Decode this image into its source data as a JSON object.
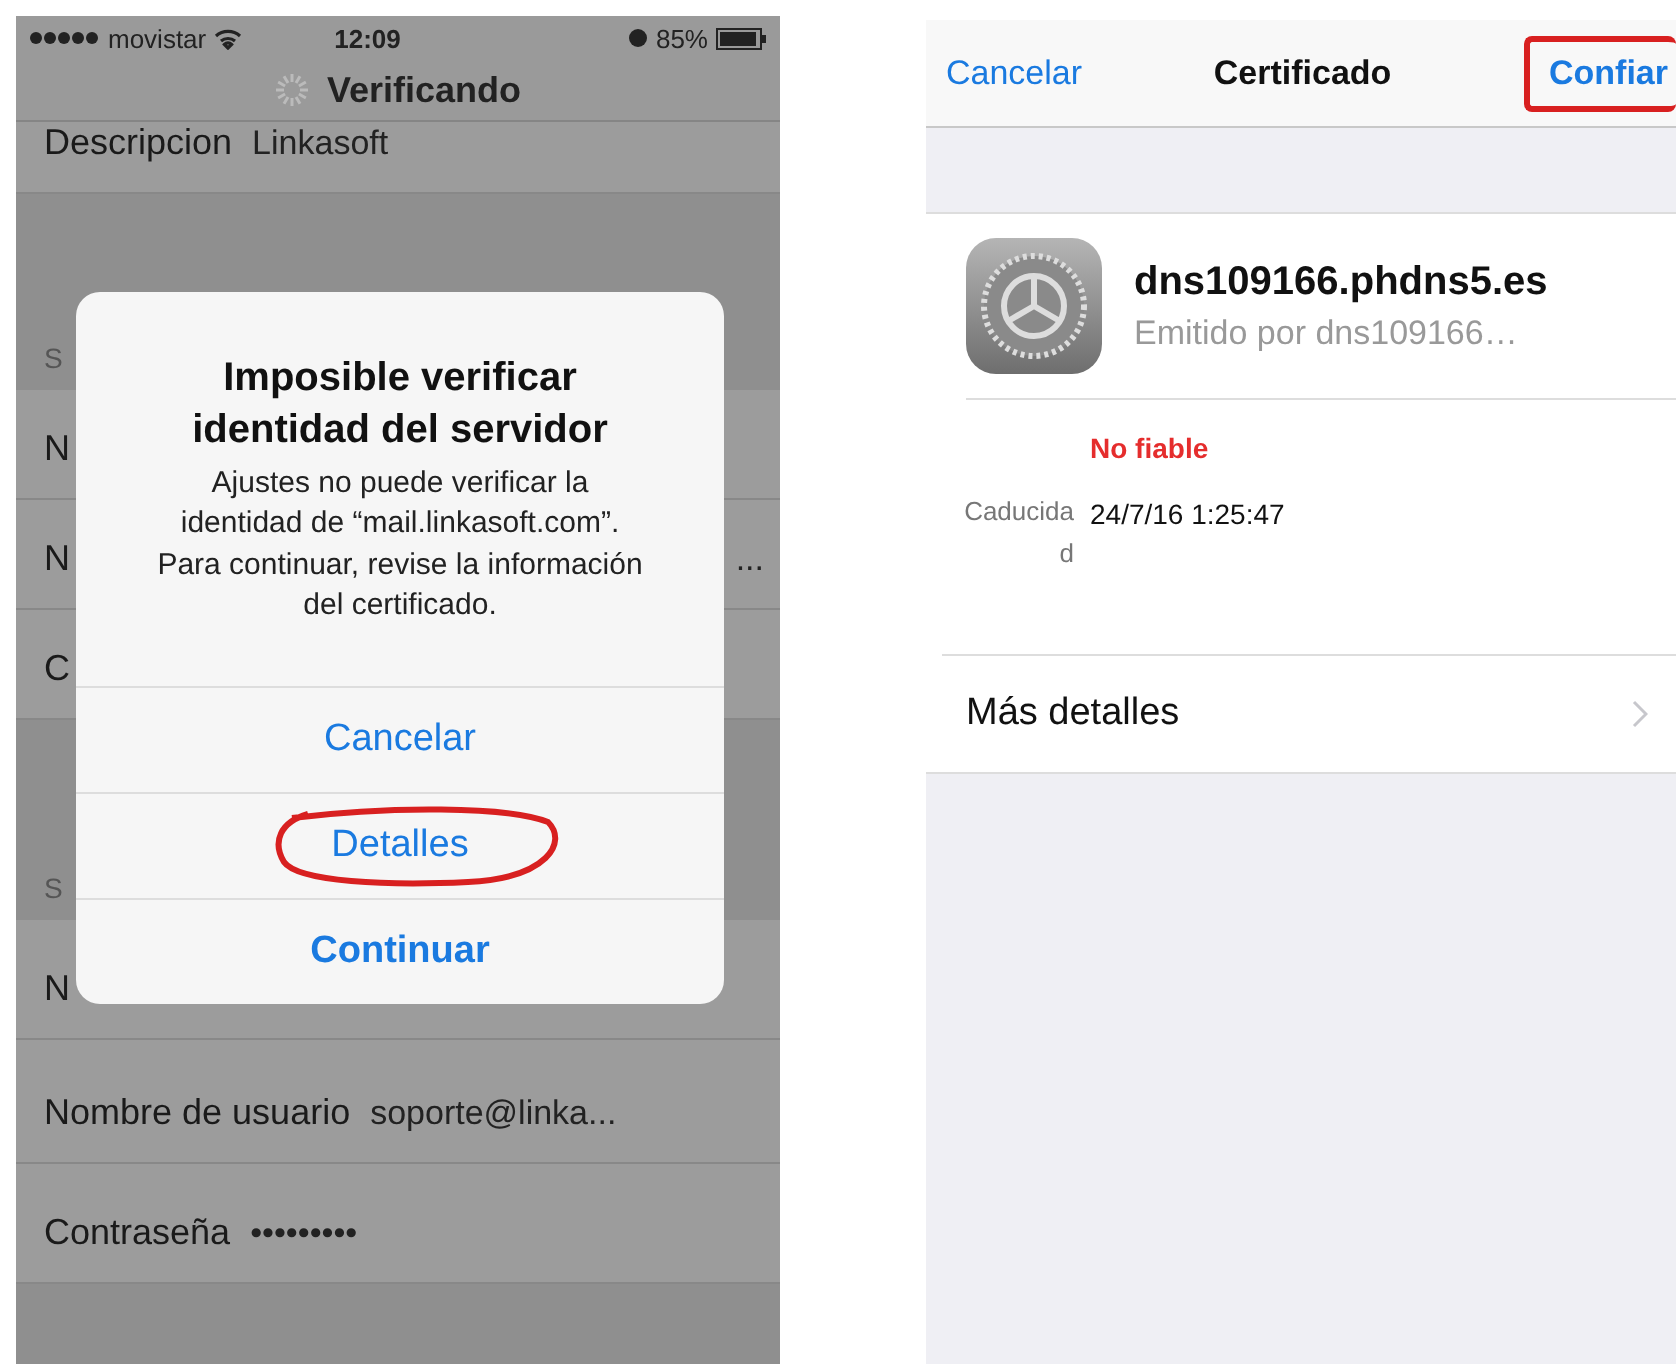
{
  "left_screen": {
    "status_bar": {
      "carrier": "movistar",
      "time": "12:09",
      "battery": "85%"
    },
    "nav_title": "Verificando",
    "rows": [
      {
        "kind": "row",
        "label": "Descripcion",
        "value": "Linkasoft"
      },
      {
        "kind": "header",
        "label": "S"
      },
      {
        "kind": "row",
        "label": "N"
      },
      {
        "kind": "row",
        "label": "N",
        "value": "..."
      },
      {
        "kind": "row",
        "label": "C"
      },
      {
        "kind": "header",
        "label": "S"
      },
      {
        "kind": "row",
        "label": "N"
      },
      {
        "kind": "row",
        "label": "Nombre de usuario",
        "value": "soporte@linka..."
      },
      {
        "kind": "row",
        "label": "Contraseña",
        "value": "•••••••••"
      }
    ],
    "alert": {
      "title": "Imposible verificar identidad del servidor",
      "message": "Ajustes no puede verificar la identidad de “mail.linkasoft.com”. Para continuar, revise la información del certificado.",
      "buttons": [
        {
          "label": "Cancelar",
          "bold": false,
          "circled": false
        },
        {
          "label": "Detalles",
          "bold": false,
          "circled": true
        },
        {
          "label": "Continuar",
          "bold": true,
          "circled": false
        }
      ]
    }
  },
  "right_screen": {
    "nav": {
      "cancel": "Cancelar",
      "title": "Certificado",
      "confirm": "Confiar",
      "confirm_circled": true
    },
    "certificate": {
      "name": "dns109166.phdns5.es",
      "issuer": "Emitido por dns109166…",
      "status": "No fiable",
      "expires_label": "Caducidad",
      "expires_value": "24/7/16 1:25:47"
    },
    "more": "Más detalles"
  }
}
